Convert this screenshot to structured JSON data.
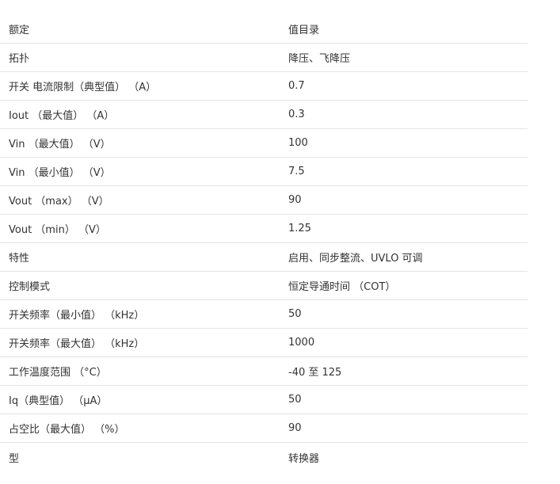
{
  "spec_table": {
    "header": {
      "label": "额定",
      "value": "值目录"
    },
    "rows": [
      {
        "label": "拓扑",
        "value": "降压、飞降压"
      },
      {
        "label": "开关 电流限制（典型值） （A）",
        "value": "0.7"
      },
      {
        "label": "Iout （最大值） （A）",
        "value": "0.3"
      },
      {
        "label": "Vin （最大值） （V）",
        "value": "100"
      },
      {
        "label": "Vin （最小值） （V）",
        "value": "7.5"
      },
      {
        "label": "Vout （max） （V）",
        "value": "90"
      },
      {
        "label": "Vout （min） （V）",
        "value": "1.25"
      },
      {
        "label": "特性",
        "value": "启用、同步整流、UVLO 可调"
      },
      {
        "label": "控制模式",
        "value": "恒定导通时间 （COT）"
      },
      {
        "label": "开关频率（最小值） （kHz）",
        "value": "50"
      },
      {
        "label": "开关频率（最大值） （kHz）",
        "value": "1000"
      },
      {
        "label": "工作温度范围 （°C）",
        "value": "-40 至 125"
      },
      {
        "label": "Iq（典型值） （µA）",
        "value": "50"
      },
      {
        "label": "占空比（最大值） （%）",
        "value": "90"
      },
      {
        "label": "型",
        "value": "转换器"
      }
    ]
  }
}
